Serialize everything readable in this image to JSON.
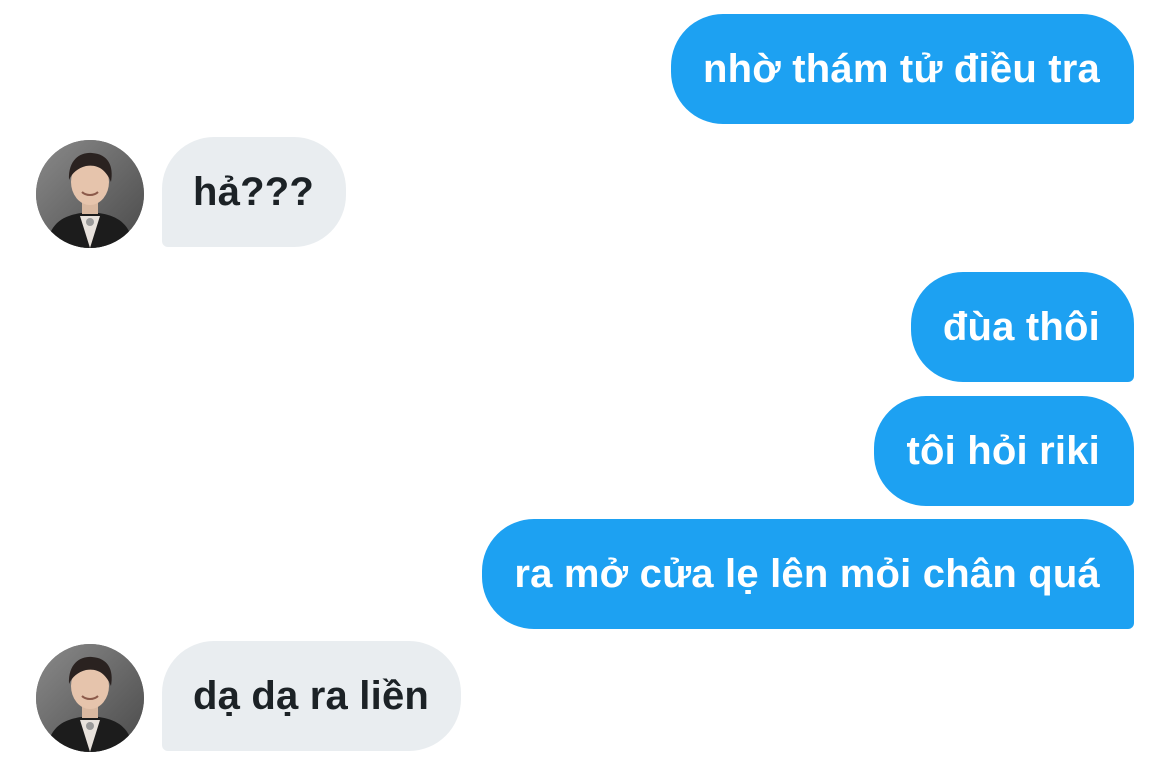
{
  "conversation": {
    "messages": [
      {
        "side": "sent",
        "text": "nhờ thám tử điều tra"
      },
      {
        "side": "received",
        "text": "hả???",
        "avatar": "profile-photo"
      },
      {
        "side": "sent",
        "text": "đùa thôi"
      },
      {
        "side": "sent",
        "text": "tôi hỏi riki"
      },
      {
        "side": "sent",
        "text": "ra mở cửa lẹ lên mỏi chân quá"
      },
      {
        "side": "received",
        "text": "dạ dạ ra liền",
        "avatar": "profile-photo"
      }
    ]
  },
  "colors": {
    "sent_bubble": "#1da1f2",
    "sent_text": "#ffffff",
    "received_bubble": "#e9edf0",
    "received_text": "#1c2226",
    "background": "#ffffff"
  }
}
